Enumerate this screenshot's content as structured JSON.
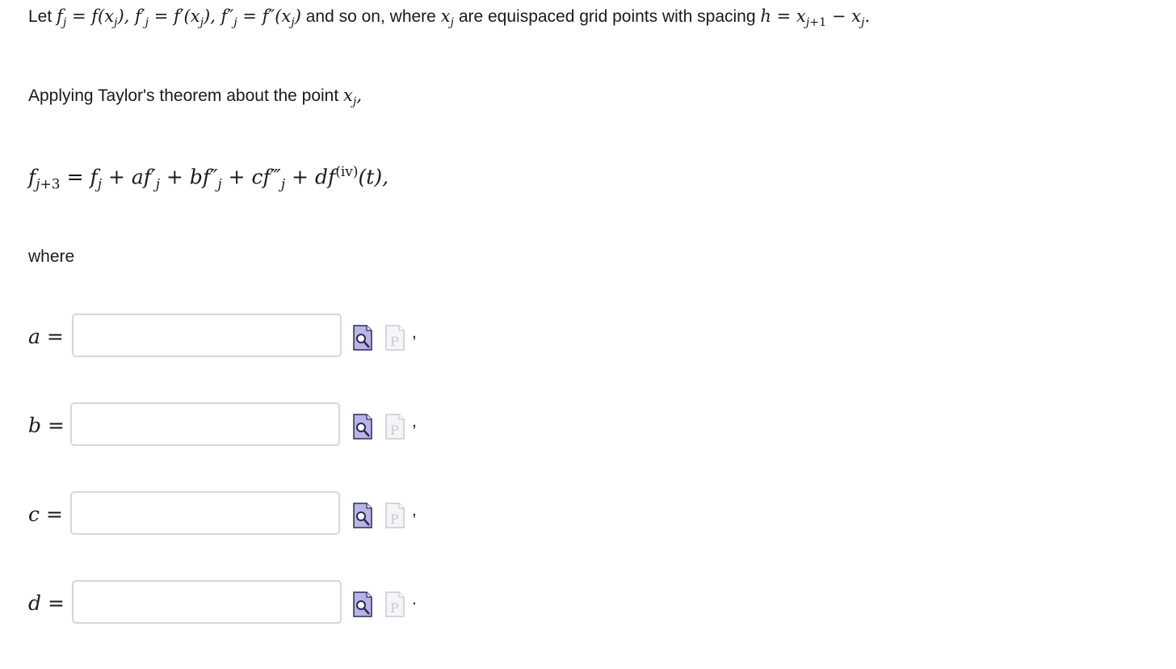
{
  "intro": {
    "let": "Let",
    "and_so_on": "and so on, where",
    "grid_points_text": "are equispaced grid points with spacing"
  },
  "apply_text": "Applying Taylor's theorem about the point",
  "where_text": "where",
  "fields": [
    {
      "var": "a",
      "value": "",
      "punct": ","
    },
    {
      "var": "b",
      "value": "",
      "punct": ","
    },
    {
      "var": "c",
      "value": "",
      "punct": ","
    },
    {
      "var": "d",
      "value": "",
      "punct": "."
    }
  ],
  "icons": {
    "preview": "preview-magnifier-icon",
    "p": "p-document-icon"
  },
  "colors": {
    "input_border": "#d7d7d7",
    "preview_icon_fill": "#b9b4e6",
    "disabled_icon": "#c9c9d4"
  }
}
